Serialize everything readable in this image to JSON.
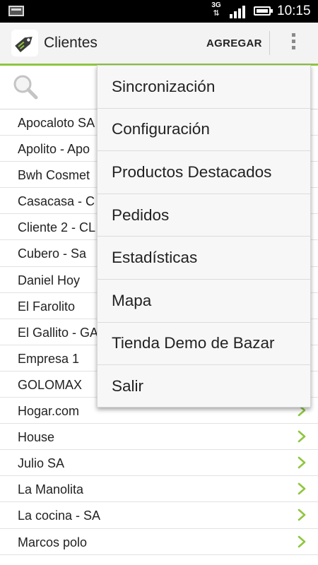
{
  "status_bar": {
    "time": "10:15",
    "network_type": "3G",
    "icons": [
      "notification-icon",
      "signal-icon",
      "battery-icon"
    ]
  },
  "action_bar": {
    "title": "Clientes",
    "add_label": "AGREGAR",
    "accent_color": "#8ec63f"
  },
  "search": {
    "icon": "search-icon"
  },
  "clients": [
    "Apocaloto SA",
    "Apolito - Apo",
    "Bwh Cosmet",
    "Casacasa - C",
    "Cliente 2 - CL",
    "Cubero - Sa",
    "Daniel Hoy",
    "El Farolito",
    "El Gallito - GA",
    "Empresa 1",
    "GOLOMAX",
    "Hogar.com",
    "House",
    "Julio SA",
    "La Manolita",
    "La cocina - SA",
    "Marcos polo"
  ],
  "menu": {
    "items": [
      "Sincronización",
      "Configuración",
      "Productos Destacados",
      "Pedidos",
      "Estadísticas",
      "Mapa",
      "Tienda Demo de Bazar",
      "Salir"
    ]
  }
}
